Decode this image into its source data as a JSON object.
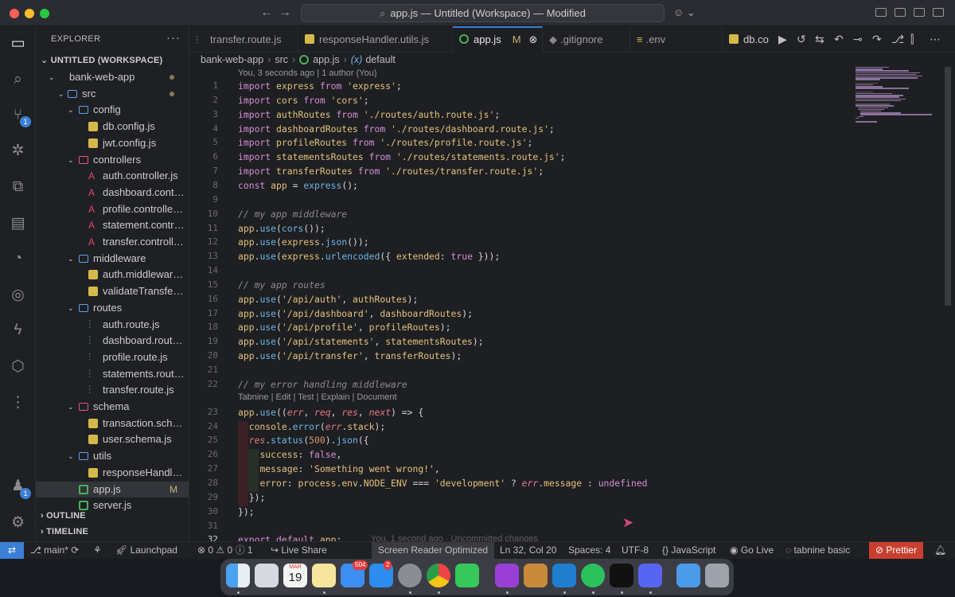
{
  "titlebar": {
    "search_text": "app.js — Untitled (Workspace) — Modified",
    "back_arrow": "←",
    "forward_arrow": "→"
  },
  "activity": {
    "source_control_badge": "1",
    "accounts_badge": "1"
  },
  "sidebar": {
    "header": "EXPLORER",
    "more": "···",
    "workspace": "UNTITLED (WORKSPACE)",
    "outline": "OUTLINE",
    "timeline": "TIMELINE",
    "items": [
      {
        "label": "bank-web-app",
        "depth": 0,
        "kind": "folder"
      },
      {
        "label": "src",
        "depth": 1,
        "kind": "folder"
      },
      {
        "label": "config",
        "depth": 2,
        "kind": "folder"
      },
      {
        "label": "db.config.js",
        "depth": 3,
        "kind": "js"
      },
      {
        "label": "jwt.config.js",
        "depth": 3,
        "kind": "js"
      },
      {
        "label": "controllers",
        "depth": 2,
        "kind": "folder"
      },
      {
        "label": "auth.controller.js",
        "depth": 3,
        "kind": "angular"
      },
      {
        "label": "dashboard.controll...",
        "depth": 3,
        "kind": "angular"
      },
      {
        "label": "profile.controller.js",
        "depth": 3,
        "kind": "angular"
      },
      {
        "label": "statement.controll...",
        "depth": 3,
        "kind": "angular"
      },
      {
        "label": "transfer.controller.js",
        "depth": 3,
        "kind": "angular"
      },
      {
        "label": "middleware",
        "depth": 2,
        "kind": "folder"
      },
      {
        "label": "auth.middleware.js",
        "depth": 3,
        "kind": "js"
      },
      {
        "label": "validateTransfer.mi...",
        "depth": 3,
        "kind": "js"
      },
      {
        "label": "routes",
        "depth": 2,
        "kind": "folder"
      },
      {
        "label": "auth.route.js",
        "depth": 3,
        "kind": "route"
      },
      {
        "label": "dashboard.route.js",
        "depth": 3,
        "kind": "route"
      },
      {
        "label": "profile.route.js",
        "depth": 3,
        "kind": "route"
      },
      {
        "label": "statements.route.js",
        "depth": 3,
        "kind": "route"
      },
      {
        "label": "transfer.route.js",
        "depth": 3,
        "kind": "route"
      },
      {
        "label": "schema",
        "depth": 2,
        "kind": "folder"
      },
      {
        "label": "transaction.schem...",
        "depth": 3,
        "kind": "js"
      },
      {
        "label": "user.schema.js",
        "depth": 3,
        "kind": "js"
      },
      {
        "label": "utils",
        "depth": 2,
        "kind": "folder"
      },
      {
        "label": "responseHandler.u...",
        "depth": 3,
        "kind": "js"
      },
      {
        "label": "app.js",
        "depth": 2,
        "kind": "node"
      },
      {
        "label": "server.js",
        "depth": 2,
        "kind": "node"
      }
    ],
    "modified_marker": "M"
  },
  "tabs": [
    {
      "label": "transfer.route.js"
    },
    {
      "label": "responseHandler.utils.js"
    },
    {
      "label": "app.js",
      "modified": "M"
    },
    {
      "label": ".gitignore"
    },
    {
      "label": ".env"
    },
    {
      "label": "db.co"
    }
  ],
  "breadcrumb": [
    "bank-web-app",
    "src",
    "app.js",
    "default"
  ],
  "blame_header": "You, 3 seconds ago | 1 author (You)",
  "tabnine_lens": "Tabnine | Edit | Test | Explain | Document",
  "line_numbers": [
    "1",
    "2",
    "3",
    "4",
    "5",
    "6",
    "7",
    "8",
    "9",
    "10",
    "11",
    "12",
    "13",
    "14",
    "15",
    "16",
    "17",
    "18",
    "19",
    "20",
    "21",
    "22",
    "23",
    "24",
    "25",
    "26",
    "27",
    "28",
    "29",
    "30",
    "31",
    "32"
  ],
  "code_lines": [
    "import express from 'express';",
    "import cors from 'cors';",
    "import authRoutes from './routes/auth.route.js';",
    "import dashboardRoutes from './routes/dashboard.route.js';",
    "import profileRoutes from './routes/profile.route.js';",
    "import statementsRoutes from './routes/statements.route.js';",
    "import transferRoutes from './routes/transfer.route.js';",
    "const app = express();",
    "",
    "// my app middleware",
    "app.use(cors());",
    "app.use(express.json());",
    "app.use(express.urlencoded({ extended: true }));",
    "",
    "// my app routes",
    "app.use('/api/auth', authRoutes);",
    "app.use('/api/dashboard', dashboardRoutes);",
    "app.use('/api/profile', profileRoutes);",
    "app.use('/api/statements', statementsRoutes);",
    "app.use('/api/transfer', transferRoutes);",
    "",
    "// my error handling middleware",
    "app.use((err, req, res, next) => {",
    "  console.error(err.stack);",
    "  res.status(500).json({",
    "    success: false,",
    "    message: 'Something went wrong!',",
    "    error: process.env.NODE_ENV === 'development' ? err.message : undefined",
    "  });",
    "});",
    "",
    "export default app;"
  ],
  "line32_blame": "You, 1 second ago · Uncommitted changes",
  "status": {
    "branch": "main*",
    "launchpad": "Launchpad",
    "problems": "0",
    "warnings": "0",
    "info": "1",
    "live_share": "Live Share",
    "screen_reader": "Screen Reader Optimized",
    "position": "Ln 32, Col 20",
    "spaces": "Spaces: 4",
    "encoding": "UTF-8",
    "language": "JavaScript",
    "go_live": "Go Live",
    "tabnine": "tabnine basic",
    "prettier": "Prettier"
  },
  "dock": {
    "calendar_month": "MAR",
    "calendar_day": "19",
    "mail_badge": "504",
    "appstore_badge": "2"
  },
  "colors": {
    "accent": "#3b7fd6",
    "prettier": "#c93f2f"
  }
}
